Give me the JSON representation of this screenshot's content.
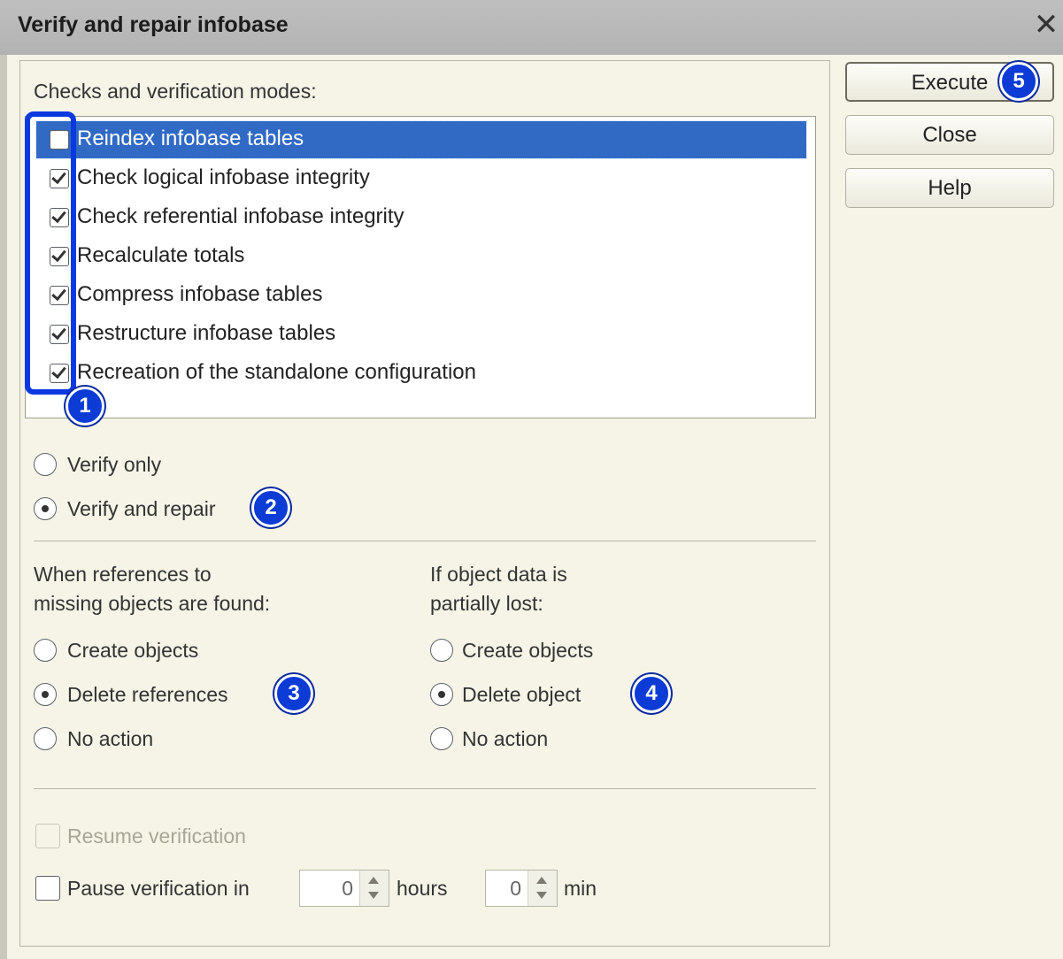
{
  "window": {
    "title": "Verify and repair infobase",
    "close_glyph": "✕"
  },
  "checks": {
    "label": "Checks and verification modes:",
    "items": [
      {
        "label": "Reindex infobase tables",
        "checked": false,
        "selected": true
      },
      {
        "label": "Check logical infobase integrity",
        "checked": true
      },
      {
        "label": "Check referential infobase integrity",
        "checked": true
      },
      {
        "label": "Recalculate totals",
        "checked": true
      },
      {
        "label": "Compress infobase tables",
        "checked": true
      },
      {
        "label": "Restructure infobase tables",
        "checked": true
      },
      {
        "label": "Recreation of the standalone configuration",
        "checked": true
      }
    ]
  },
  "mode": {
    "options": [
      {
        "label": "Verify only",
        "selected": false
      },
      {
        "label": "Verify and repair",
        "selected": true
      }
    ]
  },
  "missing_refs": {
    "label_line1": "When references to",
    "label_line2": "missing objects are found:",
    "options": [
      {
        "label": "Create objects",
        "selected": false
      },
      {
        "label": "Delete references",
        "selected": true
      },
      {
        "label": "No action",
        "selected": false
      }
    ]
  },
  "partial_loss": {
    "label_line1": "If object data is",
    "label_line2": "partially lost:",
    "options": [
      {
        "label": "Create objects",
        "selected": false
      },
      {
        "label": "Delete object",
        "selected": true
      },
      {
        "label": "No action",
        "selected": false
      }
    ]
  },
  "resume": {
    "label": "Resume verification",
    "checked": false,
    "disabled": true
  },
  "pause": {
    "label": "Pause verification in",
    "checked": false,
    "hours_value": "0",
    "hours_label": "hours",
    "min_value": "0",
    "min_label": "min"
  },
  "buttons": {
    "execute": "Execute",
    "close": "Close",
    "help": "Help"
  },
  "badges": [
    "1",
    "2",
    "3",
    "4",
    "5"
  ],
  "colors": {
    "accent": "#0d3bd6",
    "selection": "#316ac5",
    "background": "#f5f4e7"
  }
}
